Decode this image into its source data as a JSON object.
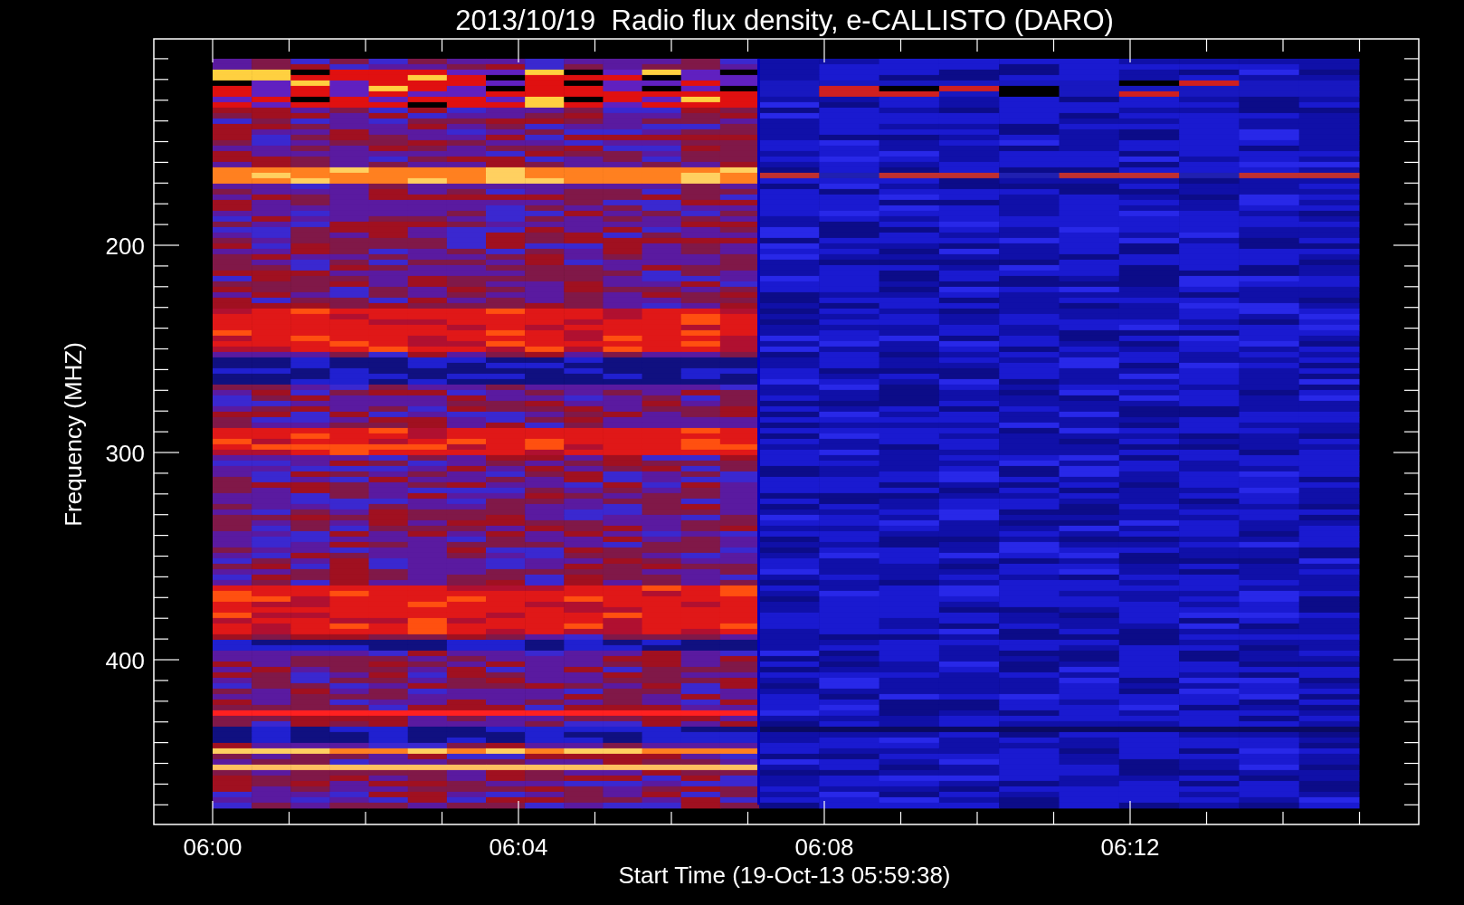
{
  "title": "2013/10/19  Radio flux density, e-CALLISTO (DARO)",
  "y_axis": {
    "label": "Frequency (MHZ)",
    "ticks": [
      "200",
      "300",
      "400"
    ]
  },
  "x_axis": {
    "label": "Start Time (19-Oct-13 05:59:38)",
    "ticks": [
      "06:00",
      "06:04",
      "06:08",
      "06:12"
    ]
  }
}
